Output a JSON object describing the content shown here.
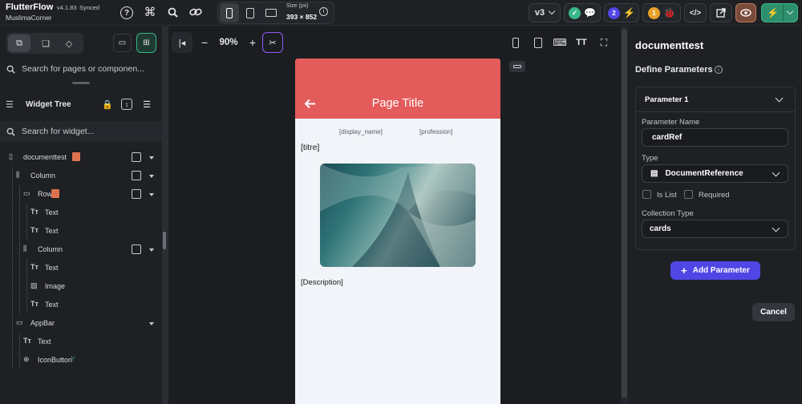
{
  "app": {
    "name": "FlutterFlow",
    "version": "v4.1.83",
    "sync_status": "Synced",
    "project": "MuslimaCorner"
  },
  "toolbar": {
    "size_label": "Size (px)",
    "size_value": "393 × 852",
    "version_badge": "v3",
    "notif_count_purple": "2",
    "notif_count_orange": "1",
    "icons": [
      "help-icon",
      "command-icon",
      "search-icon",
      "link-icon",
      "phone-icon",
      "tablet-icon",
      "desktop-icon",
      "info-icon",
      "check-icon",
      "chat-icon",
      "lightning-icon",
      "bug-icon",
      "code-icon",
      "open-external-icon",
      "eye-icon",
      "flash-icon",
      "chevron-down-icon"
    ]
  },
  "left_panel": {
    "search_pages_placeholder": "Search for pages or componen...",
    "widget_tree_title": "Widget Tree",
    "search_widgets_placeholder": "Search for widget...",
    "tree": [
      {
        "label": "documenttest",
        "icon": "phone-icon",
        "indent": 0
      },
      {
        "label": "Column",
        "icon": "column-icon",
        "indent": 1
      },
      {
        "label": "Row",
        "icon": "row-icon",
        "indent": 2
      },
      {
        "label": "Text",
        "icon": "text-icon",
        "indent": 3
      },
      {
        "label": "Text",
        "icon": "text-icon",
        "indent": 3
      },
      {
        "label": "Column",
        "icon": "column-icon",
        "indent": 2
      },
      {
        "label": "Text",
        "icon": "text-icon",
        "indent": 3
      },
      {
        "label": "Image",
        "icon": "image-icon",
        "indent": 3
      },
      {
        "label": "Text",
        "icon": "text-icon",
        "indent": 3
      },
      {
        "label": "AppBar",
        "icon": "appbar-icon",
        "indent": 1
      },
      {
        "label": "Text",
        "icon": "text-icon",
        "indent": 2
      },
      {
        "label": "IconButton",
        "icon": "add-circle-icon",
        "indent": 2
      }
    ]
  },
  "canvas": {
    "zoom": "90%",
    "page_title": "Page Title",
    "display_name": "[display_name]",
    "profession": "[profession]",
    "titre": "[titre]",
    "description": "[Description]"
  },
  "right_panel": {
    "page_name": "documenttest",
    "section_title": "Define Parameters",
    "param_header": "Parameter 1",
    "name_label": "Parameter Name",
    "name_value": "cardRef",
    "type_label": "Type",
    "type_value": "DocumentReference",
    "is_list_label": "Is List",
    "required_label": "Required",
    "collection_label": "Collection Type",
    "collection_value": "cards",
    "add_button": "Add Parameter",
    "cancel_button": "Cancel"
  },
  "colors": {
    "appbar": "#e45b5b",
    "accent_purple": "#4f46e5",
    "teal": "#39b88a"
  }
}
